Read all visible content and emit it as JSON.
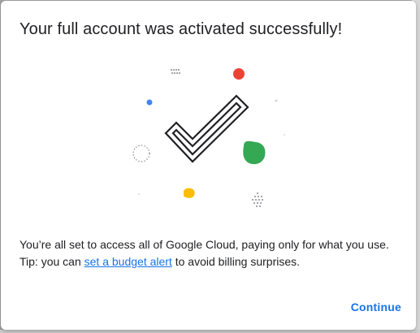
{
  "dialog": {
    "title": "Your full account was activated successfully!",
    "body_line1": "You’re all set to access all of Google Cloud, paying only for what you use.",
    "tip_prefix": "Tip: you can ",
    "tip_link": "set a budget alert",
    "tip_suffix": " to avoid billing surprises.",
    "continue_label": "Continue"
  },
  "illustration": {
    "icon": "checkmark-icon",
    "colors": {
      "red": "#ea4335",
      "blue": "#4285f4",
      "green": "#34a853",
      "yellow": "#fbbc04",
      "check_stroke": "#202124"
    }
  },
  "colors": {
    "link": "#1a73e8",
    "text": "#202124",
    "background": "#ffffff"
  }
}
